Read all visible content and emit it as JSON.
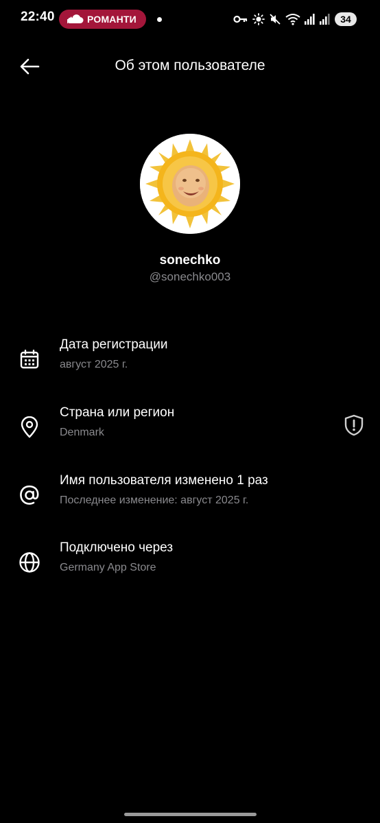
{
  "status_bar": {
    "time": "22:40",
    "media_label": "РОМАНТИ",
    "battery": "34"
  },
  "header": {
    "title": "Об этом пользователе"
  },
  "profile": {
    "display_name": "sonechko",
    "username": "@sonechko003"
  },
  "info": {
    "registration": {
      "title": "Дата регистрации",
      "value": "август 2025 г."
    },
    "country": {
      "title": "Страна или регион",
      "value": "Denmark"
    },
    "username_changes": {
      "title": "Имя пользователя изменено 1 раз",
      "value": "Последнее изменение: август 2025 г."
    },
    "connected": {
      "title": "Подключено через",
      "value": "Germany App Store"
    }
  },
  "colors": {
    "background": "#000000",
    "media_pill": "#a3163a",
    "secondary_text": "#8a8a8e"
  },
  "icons": {
    "registration": "calendar-icon",
    "country": "location-pin-icon",
    "country_trailing": "shield-alert-icon",
    "username_changes": "at-sign-icon",
    "connected": "globe-icon"
  }
}
